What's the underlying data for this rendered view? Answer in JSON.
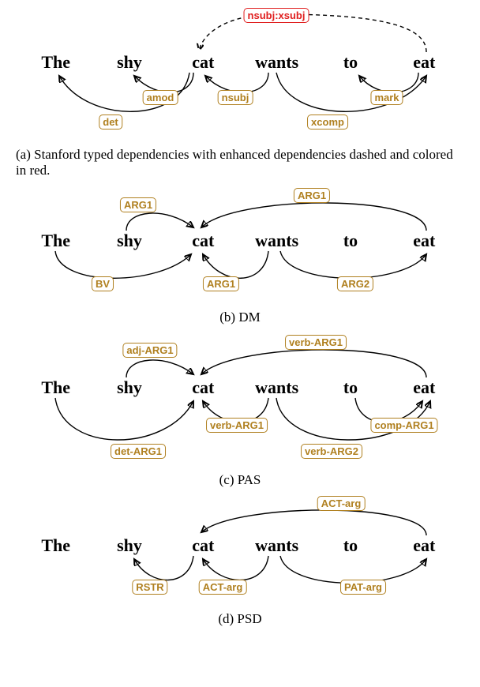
{
  "chart_data": [
    {
      "type": "dependency_diagram",
      "scheme": "Stanford typed dependencies (with enhanced)",
      "tokens": [
        "The",
        "shy",
        "cat",
        "wants",
        "to",
        "eat"
      ],
      "edges": [
        {
          "head": "eat",
          "dep": "cat",
          "label": "nsubj:xsubj",
          "enhanced": true,
          "above": true
        },
        {
          "head": "shy",
          "dep": "cat",
          "label": "amod",
          "above": false
        },
        {
          "head": "wants",
          "dep": "cat",
          "label": "nsubj",
          "above": false
        },
        {
          "head": "eat",
          "dep": "to",
          "label": "mark",
          "above": false
        },
        {
          "head": "cat",
          "dep": "The",
          "label": "det",
          "above": false
        },
        {
          "head": "wants",
          "dep": "eat",
          "label": "xcomp",
          "above": false
        }
      ]
    },
    {
      "type": "dependency_diagram",
      "scheme": "DM",
      "tokens": [
        "The",
        "shy",
        "cat",
        "wants",
        "to",
        "eat"
      ],
      "edges": [
        {
          "head": "shy",
          "dep": "cat",
          "label": "ARG1",
          "above": true
        },
        {
          "head": "eat",
          "dep": "cat",
          "label": "ARG1",
          "above": true
        },
        {
          "head": "The",
          "dep": "cat",
          "label": "BV",
          "above": false
        },
        {
          "head": "wants",
          "dep": "cat",
          "label": "ARG1",
          "above": false
        },
        {
          "head": "wants",
          "dep": "eat",
          "label": "ARG2",
          "above": false
        }
      ]
    },
    {
      "type": "dependency_diagram",
      "scheme": "PAS",
      "tokens": [
        "The",
        "shy",
        "cat",
        "wants",
        "to",
        "eat"
      ],
      "edges": [
        {
          "head": "shy",
          "dep": "cat",
          "label": "adj-ARG1",
          "above": true
        },
        {
          "head": "eat",
          "dep": "cat",
          "label": "verb-ARG1",
          "above": true
        },
        {
          "head": "wants",
          "dep": "cat",
          "label": "verb-ARG1",
          "above": false
        },
        {
          "head": "to",
          "dep": "eat",
          "label": "comp-ARG1",
          "above": false
        },
        {
          "head": "The",
          "dep": "cat",
          "label": "det-ARG1",
          "above": false
        },
        {
          "head": "wants",
          "dep": "eat",
          "label": "verb-ARG2",
          "above": false
        }
      ]
    },
    {
      "type": "dependency_diagram",
      "scheme": "PSD",
      "tokens": [
        "The",
        "shy",
        "cat",
        "wants",
        "to",
        "eat"
      ],
      "edges": [
        {
          "head": "eat",
          "dep": "cat",
          "label": "ACT-arg",
          "above": true
        },
        {
          "head": "cat",
          "dep": "shy",
          "label": "RSTR",
          "above": false
        },
        {
          "head": "wants",
          "dep": "cat",
          "label": "ACT-arg",
          "above": false
        },
        {
          "head": "wants",
          "dep": "eat",
          "label": "PAT-arg",
          "above": false
        }
      ]
    }
  ],
  "captions": {
    "a": "(a) Stanford typed dependencies with enhanced dependencies dashed and colored in red.",
    "b": "(b) DM",
    "c": "(c) PAS",
    "d": "(d) PSD"
  },
  "tokens": [
    "The",
    "shy",
    "cat",
    "wants",
    "to",
    "eat"
  ],
  "labels": {
    "a": {
      "nsubj_xsubj": "nsubj:xsubj",
      "amod": "amod",
      "nsubj": "nsubj",
      "mark": "mark",
      "det": "det",
      "xcomp": "xcomp"
    },
    "b": {
      "arg1_top_left": "ARG1",
      "arg1_top_right": "ARG1",
      "bv": "BV",
      "arg1_bot": "ARG1",
      "arg2": "ARG2"
    },
    "c": {
      "adj_arg1": "adj-ARG1",
      "verb_arg1_top": "verb-ARG1",
      "verb_arg1_bot": "verb-ARG1",
      "comp_arg1": "comp-ARG1",
      "det_arg1": "det-ARG1",
      "verb_arg2": "verb-ARG2"
    },
    "d": {
      "act_arg_top": "ACT-arg",
      "rstr": "RSTR",
      "act_arg_bot": "ACT-arg",
      "pat_arg": "PAT-arg"
    }
  }
}
